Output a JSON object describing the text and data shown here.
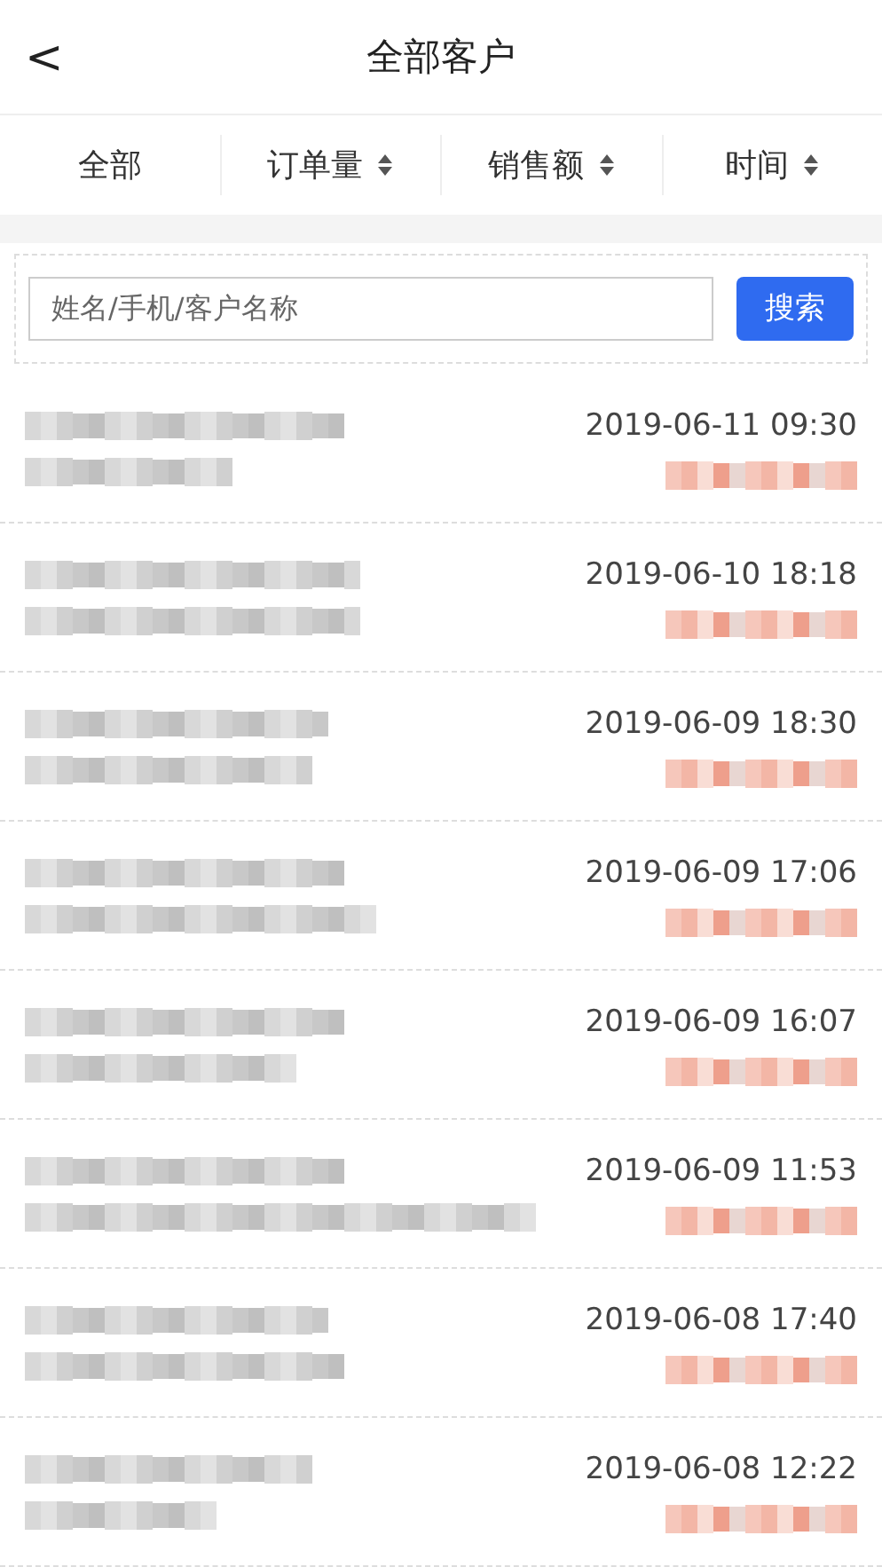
{
  "header": {
    "back": "<",
    "title": "全部客户"
  },
  "filters": [
    {
      "label": "全部",
      "sortable": false
    },
    {
      "label": "订单量",
      "sortable": true
    },
    {
      "label": "销售额",
      "sortable": true
    },
    {
      "label": "时间",
      "sortable": true
    }
  ],
  "search": {
    "placeholder": "姓名/手机/客户名称",
    "button": "搜索"
  },
  "customers": [
    {
      "time": "2019-06-11 09:30"
    },
    {
      "time": "2019-06-10 18:18"
    },
    {
      "time": "2019-06-09 18:30"
    },
    {
      "time": "2019-06-09 17:06"
    },
    {
      "time": "2019-06-09 16:07"
    },
    {
      "time": "2019-06-09 11:53"
    },
    {
      "time": "2019-06-08 17:40"
    },
    {
      "time": "2019-06-08 12:22"
    }
  ]
}
